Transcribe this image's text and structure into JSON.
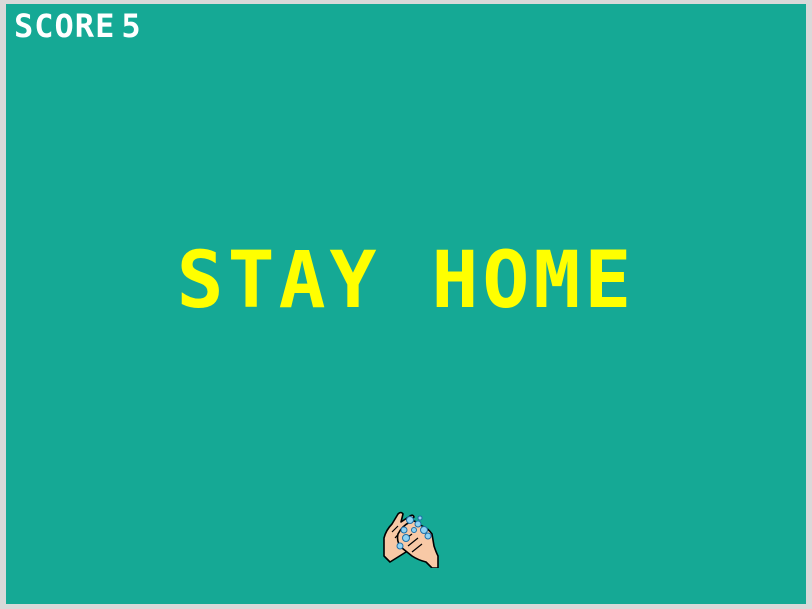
{
  "hud": {
    "score_label": "SCORE",
    "score_value": "5"
  },
  "message": {
    "text": "STAY HOME"
  },
  "player": {
    "icon": "washing-hands-icon"
  },
  "colors": {
    "background": "#15a995",
    "title": "#ffff00",
    "hud_text": "#ffffff"
  }
}
